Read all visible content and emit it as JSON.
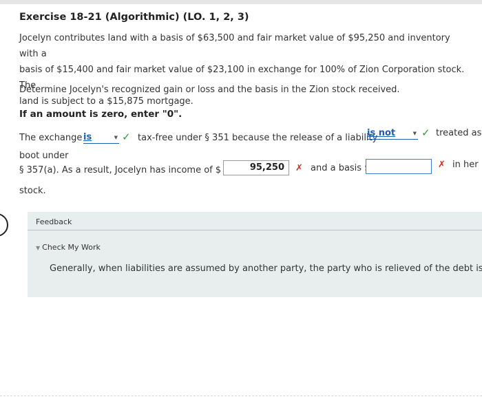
{
  "exercise": {
    "title": "Exercise 18-21 (Algorithmic) (LO. 1, 2, 3)",
    "paragraph_line1": "Jocelyn contributes land with a basis of $63,500 and fair market value of $95,250 and inventory with a",
    "paragraph_line2": "basis of $15,400 and fair market value of $23,100 in exchange for 100% of Zion Corporation stock. The",
    "paragraph_line3": "land is subject to a $15,875 mortgage.",
    "instruction": "Determine Jocelyn's recognized gain or loss and the basis in the Zion stock received.",
    "zero_note": "If an amount is zero, enter \"0\"."
  },
  "question": {
    "row1_prefix": "The exchange",
    "select1_value": "is",
    "row1_middle": "tax-free under § 351 because the release of a liability",
    "select2_value": "is not",
    "row1_suffix": "treated as",
    "row2_text": "boot under",
    "row3_prefix": "§ 357(a). As a result, Jocelyn has income of $",
    "income_value": "95,250",
    "row3_middle": "and a basis $",
    "basis_value": "",
    "row3_suffix": "in her",
    "row4_text": "stock."
  },
  "feedback": {
    "label": "Feedback",
    "check_my_work": "Check My Work",
    "text": "Generally, when liabilities are assumed by another party, the party who is relieved of the debt is trea"
  },
  "colors": {
    "correct": "#2e9c3a",
    "incorrect": "#d42a1e",
    "select_text": "#1a5fb4",
    "feedback_bg": "#e8eeee"
  },
  "icons": {
    "correct": "checkmark-icon",
    "incorrect": "x-mark-icon",
    "dropdown": "dropdown-caret-icon",
    "disclosure": "disclosure-triangle-icon"
  }
}
